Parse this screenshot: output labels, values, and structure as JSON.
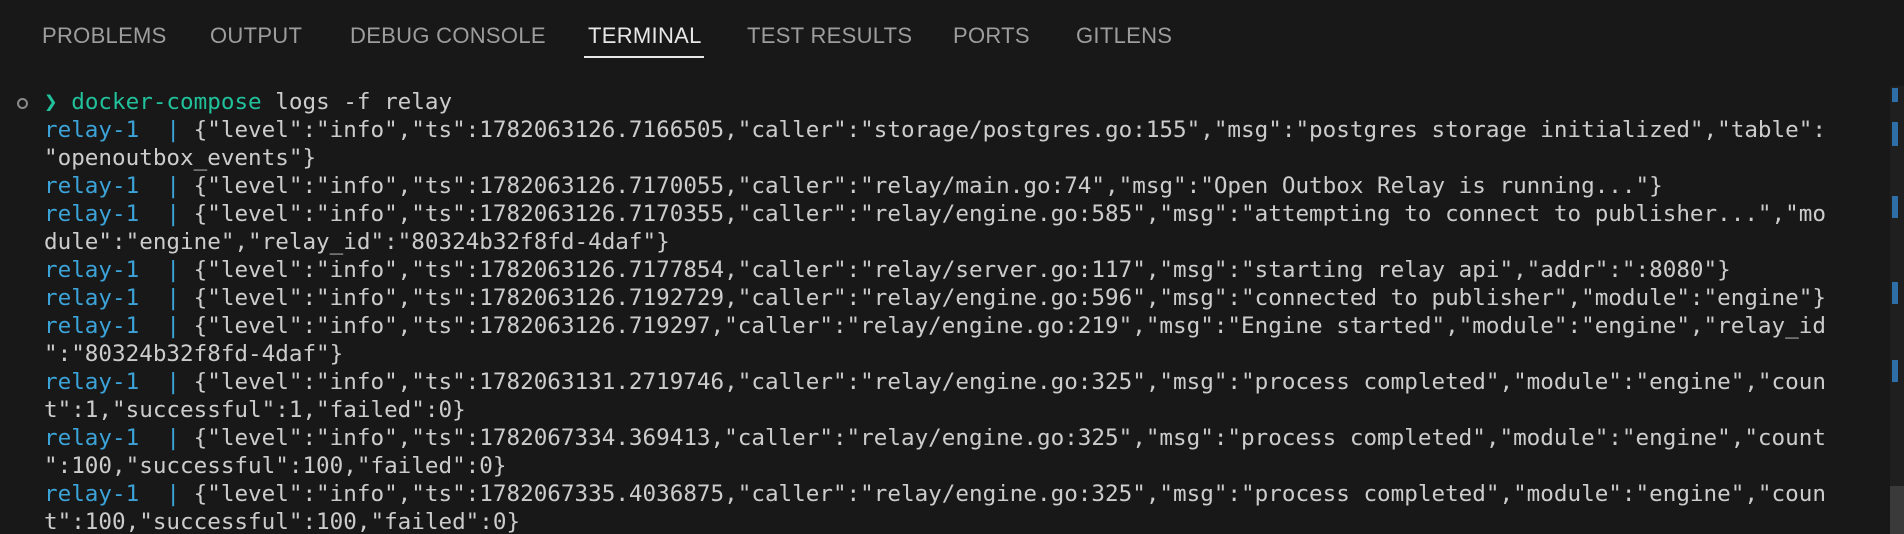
{
  "panel": {
    "tabs": [
      {
        "label": "PROBLEMS",
        "active": false
      },
      {
        "label": "OUTPUT",
        "active": false
      },
      {
        "label": "DEBUG CONSOLE",
        "active": false
      },
      {
        "label": "TERMINAL",
        "active": true
      },
      {
        "label": "TEST RESULTS",
        "active": false
      },
      {
        "label": "PORTS",
        "active": false
      },
      {
        "label": "GITLENS",
        "active": false
      }
    ]
  },
  "terminal": {
    "prompt_symbol": "❯",
    "command_name": "docker-compose",
    "command_args": " logs -f relay",
    "log_prefix": "relay-1  |",
    "lines": [
      {
        "prefix": true,
        "text": " {\"level\":\"info\",\"ts\":1782063126.7166505,\"caller\":\"storage/postgres.go:155\",\"msg\":\"postgres storage initialized\",\"table\":"
      },
      {
        "prefix": false,
        "text": "\"openoutbox_events\"}"
      },
      {
        "prefix": true,
        "text": " {\"level\":\"info\",\"ts\":1782063126.7170055,\"caller\":\"relay/main.go:74\",\"msg\":\"Open Outbox Relay is running...\"}"
      },
      {
        "prefix": true,
        "text": " {\"level\":\"info\",\"ts\":1782063126.7170355,\"caller\":\"relay/engine.go:585\",\"msg\":\"attempting to connect to publisher...\",\"mo"
      },
      {
        "prefix": false,
        "text": "dule\":\"engine\",\"relay_id\":\"80324b32f8fd-4daf\"}"
      },
      {
        "prefix": true,
        "text": " {\"level\":\"info\",\"ts\":1782063126.7177854,\"caller\":\"relay/server.go:117\",\"msg\":\"starting relay api\",\"addr\":\":8080\"}"
      },
      {
        "prefix": true,
        "text": " {\"level\":\"info\",\"ts\":1782063126.7192729,\"caller\":\"relay/engine.go:596\",\"msg\":\"connected to publisher\",\"module\":\"engine\"}"
      },
      {
        "prefix": true,
        "text": " {\"level\":\"info\",\"ts\":1782063126.719297,\"caller\":\"relay/engine.go:219\",\"msg\":\"Engine started\",\"module\":\"engine\",\"relay_id"
      },
      {
        "prefix": false,
        "text": "\":\"80324b32f8fd-4daf\"}"
      },
      {
        "prefix": true,
        "text": " {\"level\":\"info\",\"ts\":1782063131.2719746,\"caller\":\"relay/engine.go:325\",\"msg\":\"process completed\",\"module\":\"engine\",\"coun"
      },
      {
        "prefix": false,
        "text": "t\":1,\"successful\":1,\"failed\":0}"
      },
      {
        "prefix": true,
        "text": " {\"level\":\"info\",\"ts\":1782067334.369413,\"caller\":\"relay/engine.go:325\",\"msg\":\"process completed\",\"module\":\"engine\",\"count"
      },
      {
        "prefix": false,
        "text": "\":100,\"successful\":100,\"failed\":0}"
      },
      {
        "prefix": true,
        "text": " {\"level\":\"info\",\"ts\":1782067335.4036875,\"caller\":\"relay/engine.go:325\",\"msg\":\"process completed\",\"module\":\"engine\",\"coun"
      },
      {
        "prefix": false,
        "text": "t\":100,\"successful\":100,\"failed\":0}"
      }
    ]
  },
  "colors": {
    "background": "#181818",
    "prefix": "#3ba3d7",
    "command": "#21c19b",
    "text": "#cccccc",
    "active_tab": "#e7e7e7",
    "inactive_tab": "#9d9d9d"
  }
}
